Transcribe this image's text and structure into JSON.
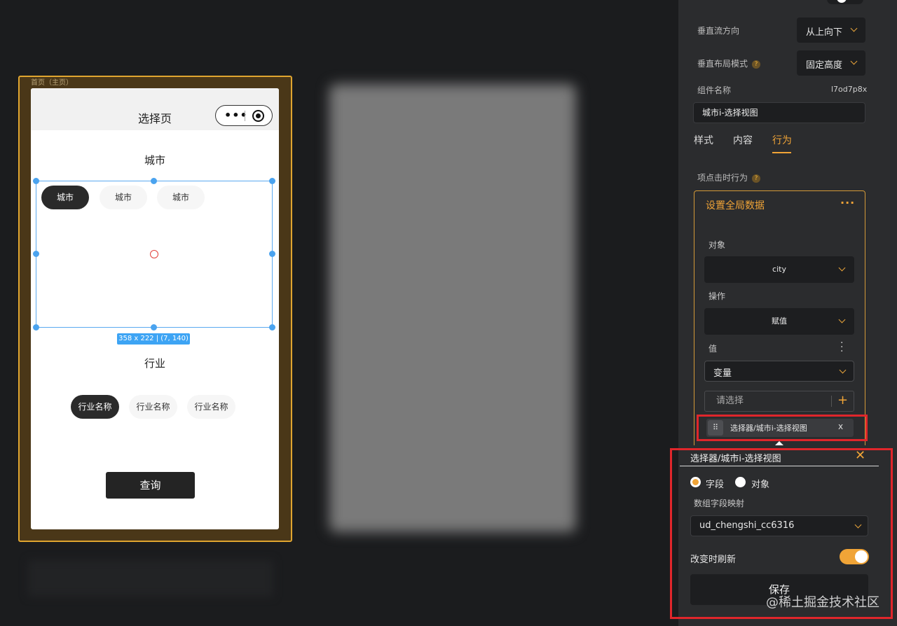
{
  "canvas": {
    "page_label": "首页（主页）",
    "phone": {
      "title": "选择页",
      "capsule_dots": "•••",
      "city_section_title": "城市",
      "city_chips": [
        "城市",
        "城市",
        "城市"
      ],
      "industry_section_title": "行业",
      "industry_chips": [
        "行业名称",
        "行业名称",
        "行业名称"
      ],
      "query_button": "查询"
    },
    "selection_size_label": "358 x 222 | (7, 140)"
  },
  "panel": {
    "vertical_flow_label": "垂直流方向",
    "vertical_flow_value": "从上向下",
    "vertical_layout_label": "垂直布局模式",
    "vertical_layout_value": "固定高度",
    "help_glyph": "?",
    "component_name_label": "组件名称",
    "component_id": "l7od7p8x",
    "component_name_value": "城市i-选择视图",
    "tabs": [
      "样式",
      "内容",
      "行为"
    ],
    "active_tab": "行为",
    "item_click_label": "项点击时行为",
    "action": {
      "title": "设置全局数据",
      "more": "···",
      "object_label": "对象",
      "object_value": "city",
      "operation_label": "操作",
      "operation_value": "赋值",
      "value_label": "值",
      "value_type": "变量",
      "choose_placeholder": "请选择",
      "plus": "+",
      "tag_text": "选择器/城市i-选择视图",
      "tag_close": "x"
    },
    "popover": {
      "title": "选择器/城市i-选择视图",
      "close": "✕",
      "radio_field": "字段",
      "radio_object": "对象",
      "mapping_label": "数组字段映射",
      "mapping_value": "ud_chengshi_cc6316",
      "refresh_label": "改变时刷新",
      "refresh_on": true,
      "save_button": "保存"
    }
  },
  "watermark": "@稀土掘金技术社区",
  "colors": {
    "accent": "#f0a437",
    "highlight_red": "#e0262b",
    "selection_blue": "#4aa3ef",
    "panel_bg": "#2b2c2e",
    "canvas_bg": "#1b1c1e"
  }
}
